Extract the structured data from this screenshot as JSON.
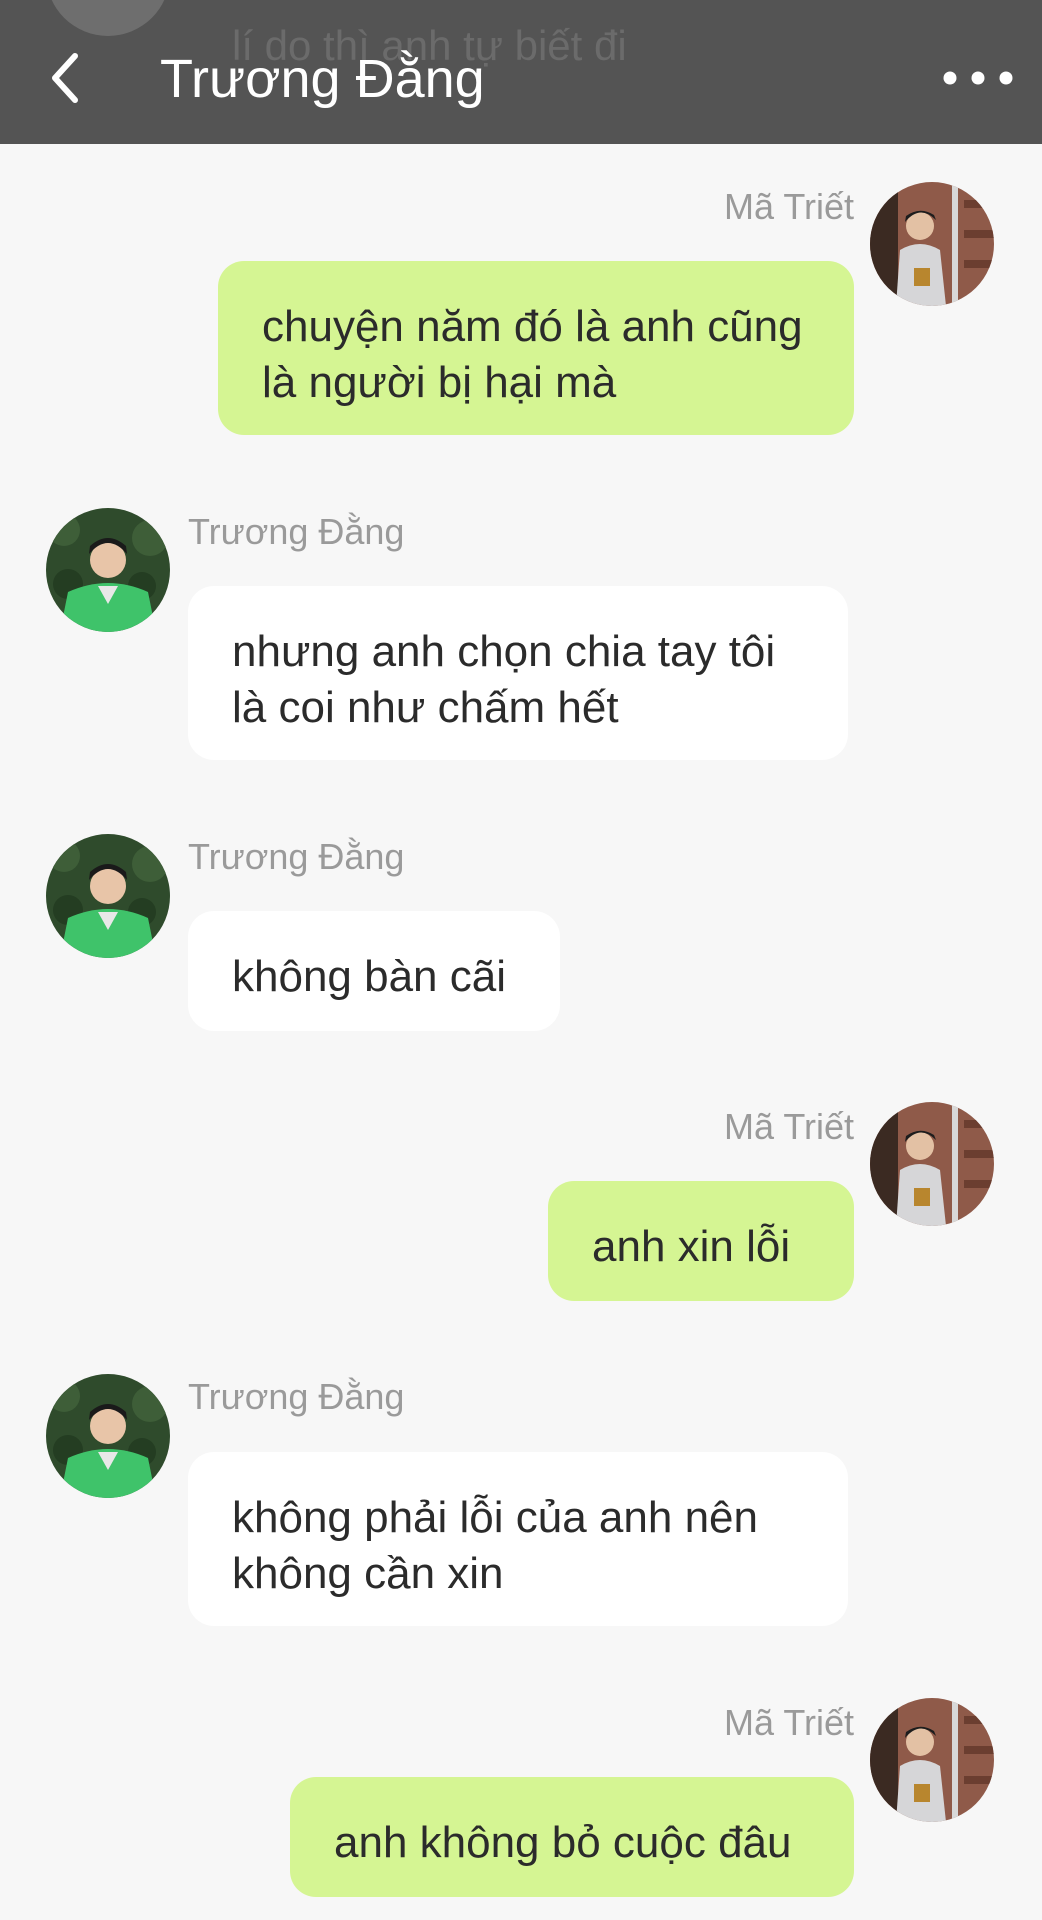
{
  "header": {
    "title": "Trương Đằng",
    "previous_message_fragment": "lí do thì anh tự biết đi"
  },
  "contacts": {
    "self": {
      "name": "Mã Triết"
    },
    "other": {
      "name": "Trương Đằng"
    }
  },
  "messages": [
    {
      "direction": "outgoing",
      "sender": "Mã Triết",
      "text": "chuyện năm đó là anh cũng là người bị hại mà"
    },
    {
      "direction": "incoming",
      "sender": "Trương Đằng",
      "text": "nhưng anh chọn chia tay tôi là coi như chấm hết"
    },
    {
      "direction": "incoming",
      "sender": "Trương Đằng",
      "text": "không bàn cãi"
    },
    {
      "direction": "outgoing",
      "sender": "Mã Triết",
      "text": "anh xin lỗi"
    },
    {
      "direction": "incoming",
      "sender": "Trương Đằng",
      "text": "không phải lỗi của anh nên không cần xin"
    },
    {
      "direction": "outgoing",
      "sender": "Mã Triết",
      "text": "anh không bỏ cuộc đâu"
    }
  ],
  "colors": {
    "header_bg": "#545454",
    "chat_bg": "#f7f7f7",
    "outgoing_bubble": "#d5f593",
    "incoming_bubble": "#ffffff",
    "sender_name": "#9a9a9a"
  },
  "icons": {
    "back": "chevron-left-icon",
    "more": "more-horizontal-icon"
  }
}
